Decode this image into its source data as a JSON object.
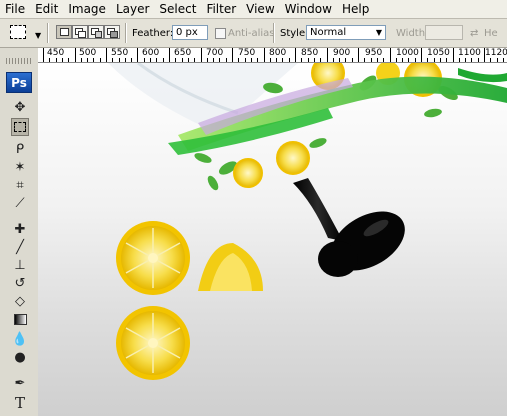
{
  "menu": {
    "items": [
      "File",
      "Edit",
      "Image",
      "Layer",
      "Select",
      "Filter",
      "View",
      "Window",
      "Help"
    ]
  },
  "options": {
    "feather_label": "Feather:",
    "feather_value": "0 px",
    "antialias_label": "Anti-alias",
    "style_label": "Style:",
    "style_value": "Normal",
    "width_label": "Width:",
    "height_label": "He"
  },
  "toolbox": {
    "logo": "Ps",
    "tools": [
      "move-tool",
      "rectangular-marquee-tool",
      "lasso-tool",
      "magic-wand-tool",
      "crop-tool",
      "eyedropper-tool",
      "healing-brush-tool",
      "brush-tool",
      "clone-stamp-tool",
      "history-brush-tool",
      "eraser-tool",
      "gradient-tool",
      "blur-tool",
      "dodge-tool",
      "pen-tool",
      "type-tool"
    ],
    "active_tool": "rectangular-marquee-tool"
  },
  "ruler": {
    "labels": [
      "450",
      "500",
      "550",
      "600",
      "650",
      "700",
      "750",
      "800",
      "850",
      "900",
      "950",
      "1000",
      "1050",
      "1100",
      "1120"
    ]
  },
  "colors": {
    "lemon": "#f4d21a",
    "leaf_green": "#3fbf3a",
    "glass_black": "#0a0a0a"
  }
}
